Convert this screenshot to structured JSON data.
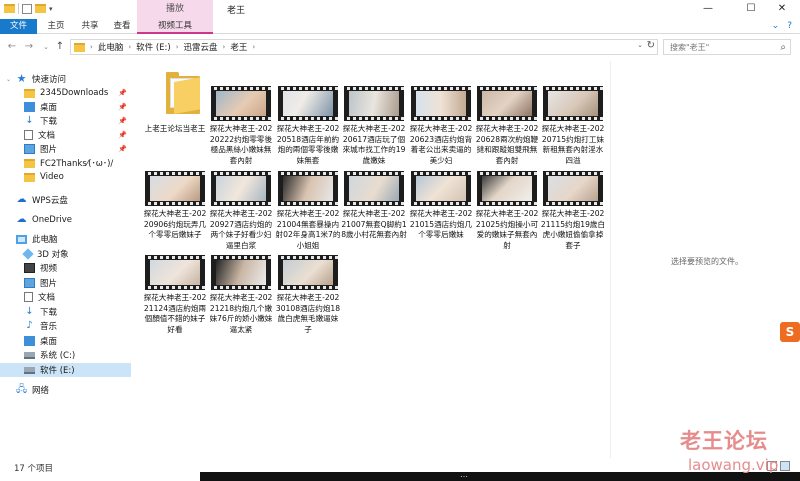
{
  "window": {
    "title": "老王",
    "minimize": "—",
    "maximize": "☐",
    "close": "✕"
  },
  "ribbon": {
    "context_group": "播放",
    "tabs": [
      "文件",
      "主页",
      "共享",
      "查看",
      "视频工具"
    ],
    "help": "?"
  },
  "address": {
    "crumbs": [
      "此电脑",
      "软件 (E:)",
      "迅雷云盘",
      "老王"
    ]
  },
  "search": {
    "placeholder": "搜索\"老王\""
  },
  "nav": {
    "items": [
      {
        "label": "快速访问",
        "icon": "star-icon"
      },
      {
        "label": "2345Downloads",
        "icon": "folder-icon",
        "pinned": true
      },
      {
        "label": "桌面",
        "icon": "desktop-icon",
        "pinned": true
      },
      {
        "label": "下载",
        "icon": "download-icon",
        "pinned": true
      },
      {
        "label": "文档",
        "icon": "document-icon",
        "pinned": true
      },
      {
        "label": "图片",
        "icon": "picture-icon",
        "pinned": true
      },
      {
        "label": "FC2Thanks⁄(･ω･)/",
        "icon": "folder-icon"
      },
      {
        "label": "Video",
        "icon": "folder-icon"
      },
      {
        "label": "WPS云盘",
        "icon": "cloud-icon"
      },
      {
        "label": "OneDrive",
        "icon": "onedrive-icon"
      },
      {
        "label": "此电脑",
        "icon": "pc-icon"
      },
      {
        "label": "3D 对象",
        "icon": "3d-icon"
      },
      {
        "label": "视频",
        "icon": "video-icon"
      },
      {
        "label": "图片",
        "icon": "picture-icon"
      },
      {
        "label": "文档",
        "icon": "document-icon"
      },
      {
        "label": "下载",
        "icon": "download-icon"
      },
      {
        "label": "音乐",
        "icon": "music-icon"
      },
      {
        "label": "桌面",
        "icon": "desktop-icon"
      },
      {
        "label": "系统 (C:)",
        "icon": "drive-icon"
      },
      {
        "label": "软件 (E:)",
        "icon": "drive-icon",
        "selected": true
      },
      {
        "label": "网络",
        "icon": "network-icon"
      }
    ]
  },
  "files": [
    {
      "name": "上老王论坛当老王",
      "type": "folder"
    },
    {
      "name": "探花大神老王-20220222约炮零零後極品黑絲小嫩妹無套內射",
      "type": "video"
    },
    {
      "name": "探花大神老王-20220518酒店年前約炮的兩個零零後嫩妹無套",
      "type": "video"
    },
    {
      "name": "探花大神老王-20220617酒店玩了個來城市找工作的19歲嫩妹",
      "type": "video"
    },
    {
      "name": "探花大神老王-20220623酒店约炮背着老公出来卖逼的美少妇",
      "type": "video"
    },
    {
      "name": "探花大神老王-20220628兩次約炮鞭撻和跟蹤姐雙飛無套內射",
      "type": "video"
    },
    {
      "name": "探花大神老王-20220715约炮打工妹新租無套內射淫水四溢",
      "type": "video"
    },
    {
      "name": "探花大神老王-20220906约炮玩弄几个零零后嫩妹子",
      "type": "video"
    },
    {
      "name": "探花大神老王-20220927酒店约炮的两个妹子好看少妇逼里白浆",
      "type": "video"
    },
    {
      "name": "探花大神老王-20221004無套暴操内射02年身高1米7的小姐姐",
      "type": "video"
    },
    {
      "name": "探花大神老王-20221007無套Q脚約18歲小村花無套內射",
      "type": "video"
    },
    {
      "name": "探花大神老王-20221015酒店约炮几个零零后嫩妹",
      "type": "video"
    },
    {
      "name": "探花大神老王-20221025约炮操小可爱的嫩妹子無套內射",
      "type": "video"
    },
    {
      "name": "探花大神老王-20221115约炮19歲白虎小嫩妞偷偷拿掉套子",
      "type": "video"
    },
    {
      "name": "探花大神老王-20221124酒店約炮兩個顏值不錯的妹子 好看",
      "type": "video"
    },
    {
      "name": "探花大神老王-20221218约炮几个嫩妹76斤的娇小嫩妹逼太紧",
      "type": "video"
    },
    {
      "name": "探花大神老王-20230108酒店约炮18歲白虎無毛嫩逼妹子",
      "type": "video"
    }
  ],
  "preview": {
    "empty_text": "选择要预览的文件。"
  },
  "status": {
    "count": "17 个项目"
  },
  "watermark": {
    "brand": "老王论坛",
    "url": "laowang.vip"
  },
  "side_badge": "S",
  "taskbar_text": "…"
}
